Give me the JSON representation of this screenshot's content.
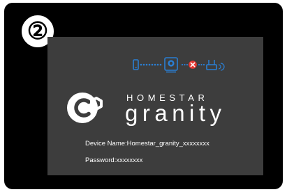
{
  "step": {
    "number": "②"
  },
  "screen": {
    "connection_status": {
      "icons": [
        "phone-icon",
        "device-icon",
        "error-icon",
        "router-icon"
      ],
      "colors": {
        "phone": "#2a7fd4",
        "device": "#2a7fd4",
        "error": "#e53935",
        "router": "#2a7fd4"
      },
      "error_link": "device-to-router"
    },
    "brand": {
      "logo_icon": "granity-logo-icon",
      "top_text": "HOMESTAR",
      "main_text": "granity"
    },
    "device_name": "Device Name:Homestar_granity_xxxxxxxx",
    "password": "Password:xxxxxxxx"
  }
}
